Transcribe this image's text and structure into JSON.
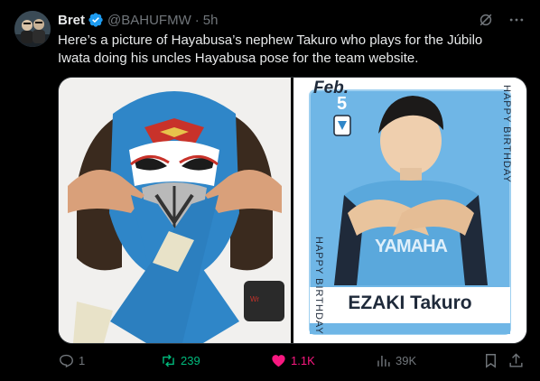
{
  "tweet": {
    "name": "Bret",
    "handle": "@BAHUFMW",
    "dot": "·",
    "time": "5h",
    "text": "Here’s a picture of Hayabusa’s nephew Takuro who plays for the Júbilo Iwata doing his uncles Hayabusa pose for the team website."
  },
  "birthday_card": {
    "month": "Feb.",
    "day": "5",
    "side_text_right": "HAPPY BIRTHDAY",
    "side_text_left": "HAPPY BIRTHDAY",
    "shirt_sponsor": "YAMAHA",
    "player_name": "EZAKI Takuro"
  },
  "actions": {
    "replies": "1",
    "reposts": "239",
    "likes": "1.1K",
    "views": "39K"
  },
  "colors": {
    "background": "#000000",
    "text": "#e7e9ea",
    "muted": "#71767b",
    "verified": "#1d9bf0",
    "repost": "#00ba7c",
    "like": "#f91880",
    "jubilo_blue": "#6fb6e6"
  },
  "icons": [
    "verified-badge-icon",
    "grok-icon",
    "more-icon",
    "reply-icon",
    "repost-icon",
    "like-icon",
    "views-icon",
    "bookmark-icon",
    "share-icon"
  ]
}
